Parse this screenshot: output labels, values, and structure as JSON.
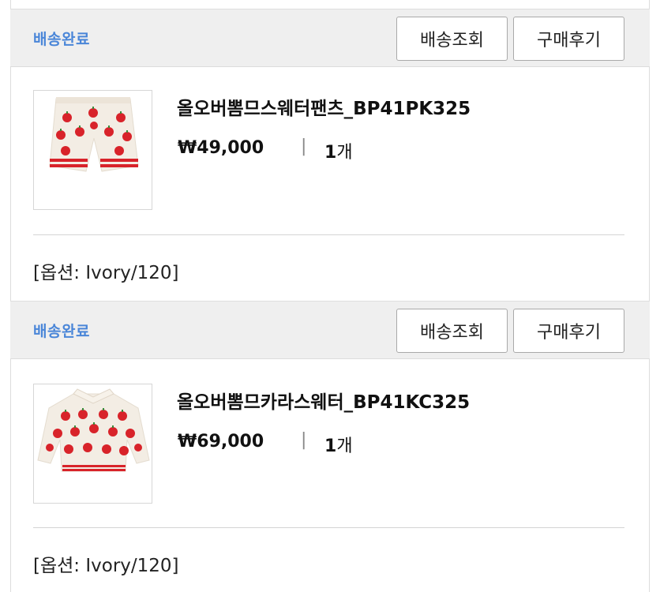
{
  "orders": [
    {
      "status": "배송완료",
      "track_button": "배송조회",
      "review_button": "구매후기",
      "product_name": "올오버뽐므스웨터팬츠_BP41PK325",
      "price": "₩49,000",
      "separator": "|",
      "quantity_number": "1",
      "quantity_unit": "개",
      "option": "[옵션: Ivory/120]",
      "thumbnail": "apple-pattern-shorts"
    },
    {
      "status": "배송완료",
      "track_button": "배송조회",
      "review_button": "구매후기",
      "product_name": "올오버뽐므카라스웨터_BP41KC325",
      "price": "₩69,000",
      "separator": "|",
      "quantity_number": "1",
      "quantity_unit": "개",
      "option": "[옵션: Ivory/120]",
      "thumbnail": "apple-pattern-collar-sweater"
    }
  ],
  "colors": {
    "status_blue": "#4a86d8",
    "header_gray": "#efefef",
    "apple_red": "#d8232a"
  }
}
